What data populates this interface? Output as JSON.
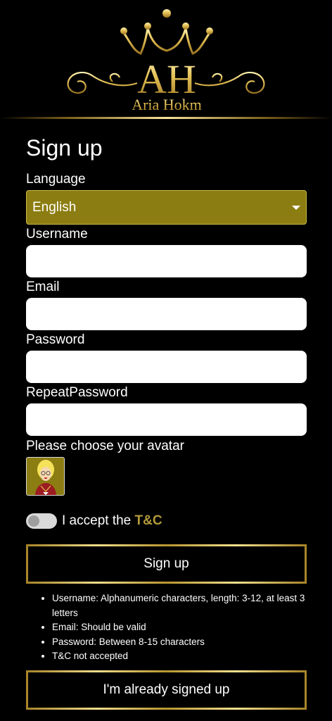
{
  "logo": {
    "monogram": "AH",
    "brand_name": "Aria Hokm"
  },
  "form": {
    "title": "Sign up",
    "language_label": "Language",
    "language_value": "English",
    "username_label": "Username",
    "username_value": "",
    "email_label": "Email",
    "email_value": "",
    "password_label": "Password",
    "password_value": "",
    "repeat_password_label": "RepeatPassword",
    "repeat_password_value": "",
    "avatar_label": "Please choose your avatar",
    "terms_prefix": "I accept the ",
    "terms_link": "T&C",
    "terms_accepted": false,
    "signup_button": "Sign up",
    "already_signed_button": "I'm already signed up"
  },
  "validation_errors": [
    "Username: Alphanumeric characters, length: 3-12, at least 3 letters",
    "Email: Should be valid",
    "Password: Between 8-15 characters",
    "T&C not accepted"
  ],
  "colors": {
    "background": "#000000",
    "gold": "#c8a93d",
    "select_bg": "#8c7d12",
    "link_gold": "#b49a3c"
  },
  "icons": {
    "crown": "crown-icon",
    "caret": "chevron-down-icon",
    "avatar": "avatar-blonde-woman"
  }
}
